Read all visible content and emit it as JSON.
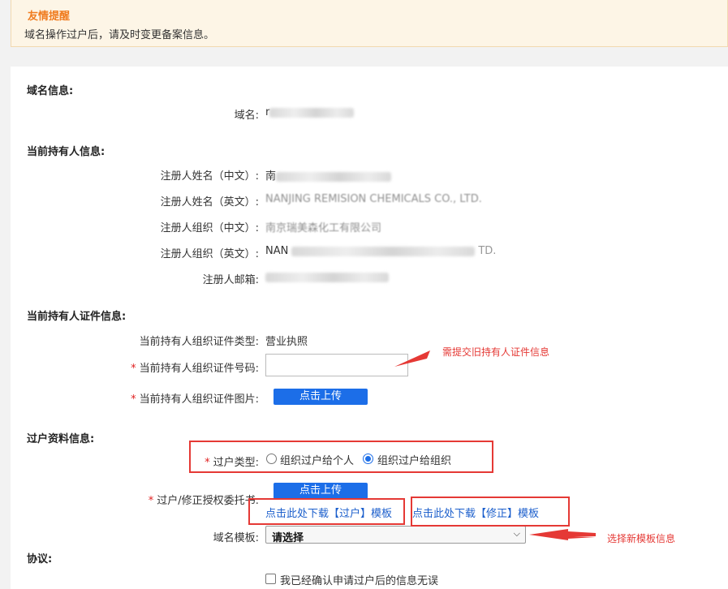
{
  "notice": {
    "title": "友情提醒",
    "text": "域名操作过户后，请及时变更备案信息。"
  },
  "domain_info": {
    "section_title": "域名信息:",
    "domain_label": "域名:",
    "domain_value": "r"
  },
  "holder_info": {
    "section_title": "当前持有人信息:",
    "name_cn_label": "注册人姓名（中文）:",
    "name_cn_value": "南",
    "name_en_label": "注册人姓名（英文）:",
    "name_en_value": "NANJING REMISION CHEMICALS CO., LTD.",
    "org_cn_label": "注册人组织（中文）:",
    "org_cn_value": "南京瑞美森化工有限公司",
    "org_en_label": "注册人组织（英文）:",
    "org_en_value": "NAN",
    "org_en_tail": "TD.",
    "email_label": "注册人邮箱:"
  },
  "holder_cert": {
    "section_title": "当前持有人证件信息:",
    "type_label": "当前持有人组织证件类型:",
    "type_value": "营业执照",
    "number_label": "当前持有人组织证件号码:",
    "number_value": "",
    "image_label": "当前持有人组织证件图片:",
    "upload_label": "点击上传"
  },
  "transfer": {
    "section_title": "过户资料信息:",
    "type_label": "过户类型:",
    "option_personal": "组织过户给个人",
    "option_org": "组织过户给组织",
    "selected": "组织过户给组织",
    "auth_label": "过户/修正授权委托书:",
    "upload_label": "点击上传",
    "download_transfer": "点击此处下载【过户】模板",
    "download_correct": "点击此处下载【修正】模板",
    "template_label": "域名模板:",
    "template_value": "请选择"
  },
  "agreement": {
    "section_title": "协议:",
    "confirm_label": "我已经确认申请过户后的信息无误",
    "checked": false
  },
  "annotations": {
    "cert_note": "需提交旧持有人证件信息",
    "template_note": "选择新模板信息"
  },
  "colors": {
    "accent": "#1c6ee8",
    "annotation": "#e53935",
    "notice_title": "#f07c1f",
    "notice_bg": "#fdf5e6"
  }
}
